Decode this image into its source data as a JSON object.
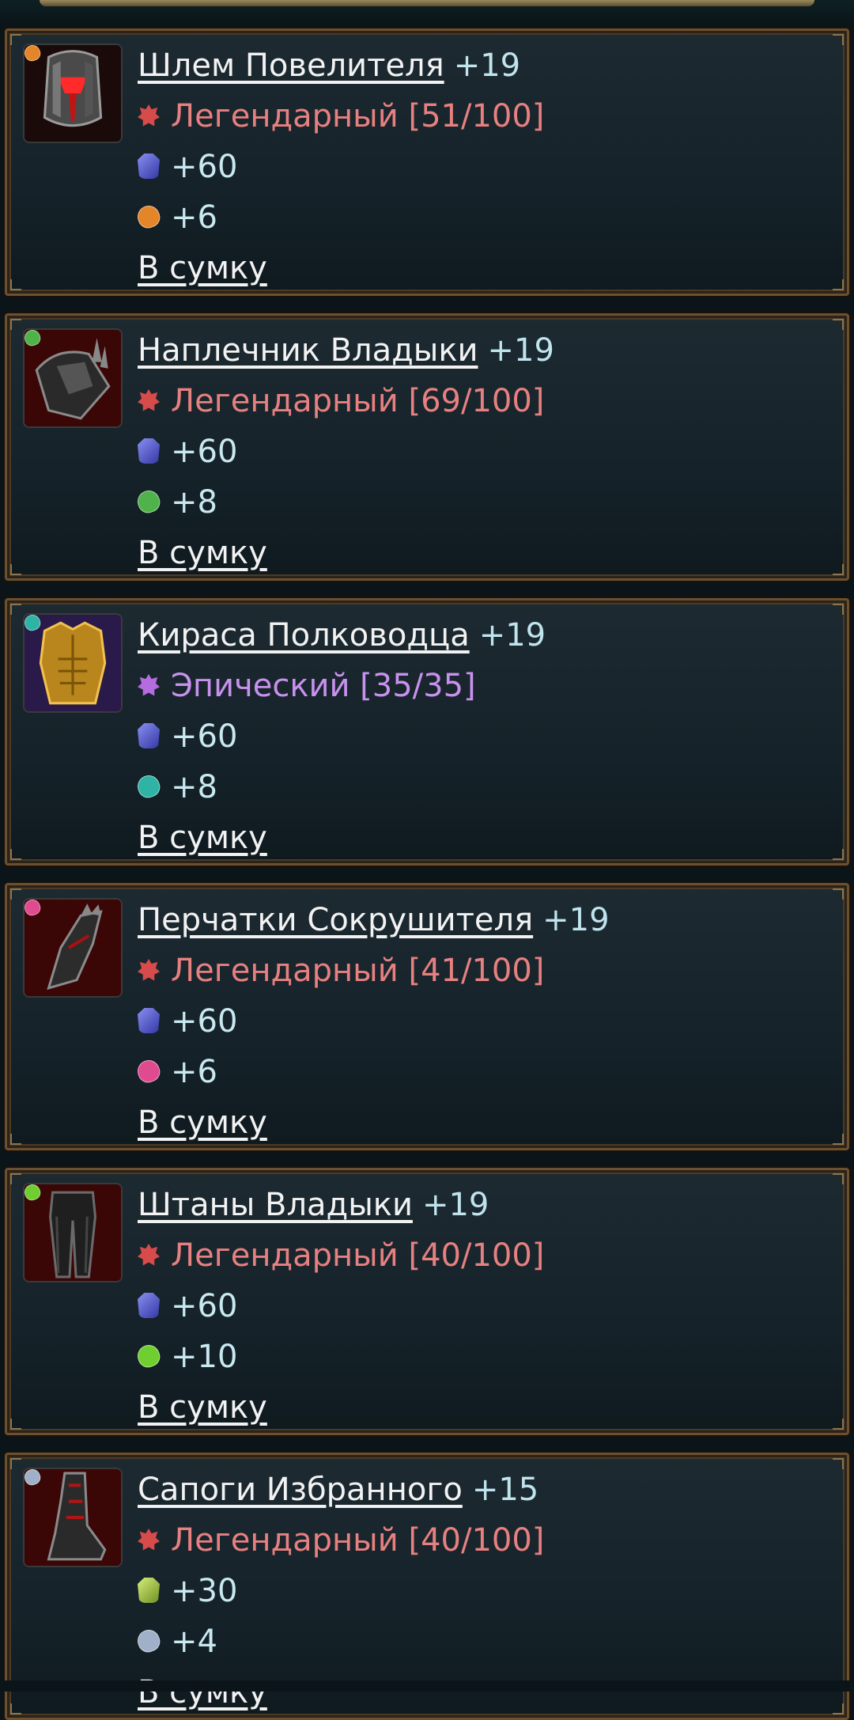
{
  "items": [
    {
      "name": "Шлем Повелителя",
      "level": "+19",
      "rarity": "Легендарный [51/100]",
      "rarity_type": "legendary",
      "armor": "+60",
      "armor_color": "blue",
      "stone": "+6",
      "stone_color": "#e5852a",
      "gem_color": "#e5852a",
      "icon": "helmet-icon",
      "bag": "В сумку"
    },
    {
      "name": "Наплечник Владыки",
      "level": "+19",
      "rarity": "Легендарный [69/100]",
      "rarity_type": "legendary",
      "armor": "+60",
      "armor_color": "blue",
      "stone": "+8",
      "stone_color": "#4fb24a",
      "gem_color": "#4fb24a",
      "icon": "pauldron-icon",
      "bag": "В сумку"
    },
    {
      "name": "Кираса Полководца",
      "level": "+19",
      "rarity": "Эпический [35/35]",
      "rarity_type": "epic",
      "armor": "+60",
      "armor_color": "blue",
      "stone": "+8",
      "stone_color": "#2fb3a5",
      "gem_color": "#2fb3a5",
      "icon": "cuirass-icon",
      "bag": "В сумку"
    },
    {
      "name": "Перчатки Сокрушителя",
      "level": "+19",
      "rarity": "Легендарный [41/100]",
      "rarity_type": "legendary",
      "armor": "+60",
      "armor_color": "blue",
      "stone": "+6",
      "stone_color": "#e04a8f",
      "gem_color": "#e04a8f",
      "icon": "gloves-icon",
      "bag": "В сумку"
    },
    {
      "name": "Штаны Владыки",
      "level": "+19",
      "rarity": "Легендарный [40/100]",
      "rarity_type": "legendary",
      "armor": "+60",
      "armor_color": "blue",
      "stone": "+10",
      "stone_color": "#6fcf2e",
      "gem_color": "#6fcf2e",
      "icon": "pants-icon",
      "bag": "В сумку"
    },
    {
      "name": "Сапоги Избранного",
      "level": "+15",
      "rarity": "Легендарный [40/100]",
      "rarity_type": "legendary",
      "armor": "+30",
      "armor_color": "green",
      "stone": "+4",
      "stone_color": "#9fb0c8",
      "gem_color": "#9fb0c8",
      "icon": "boots-icon",
      "bag": "В сумку"
    }
  ]
}
